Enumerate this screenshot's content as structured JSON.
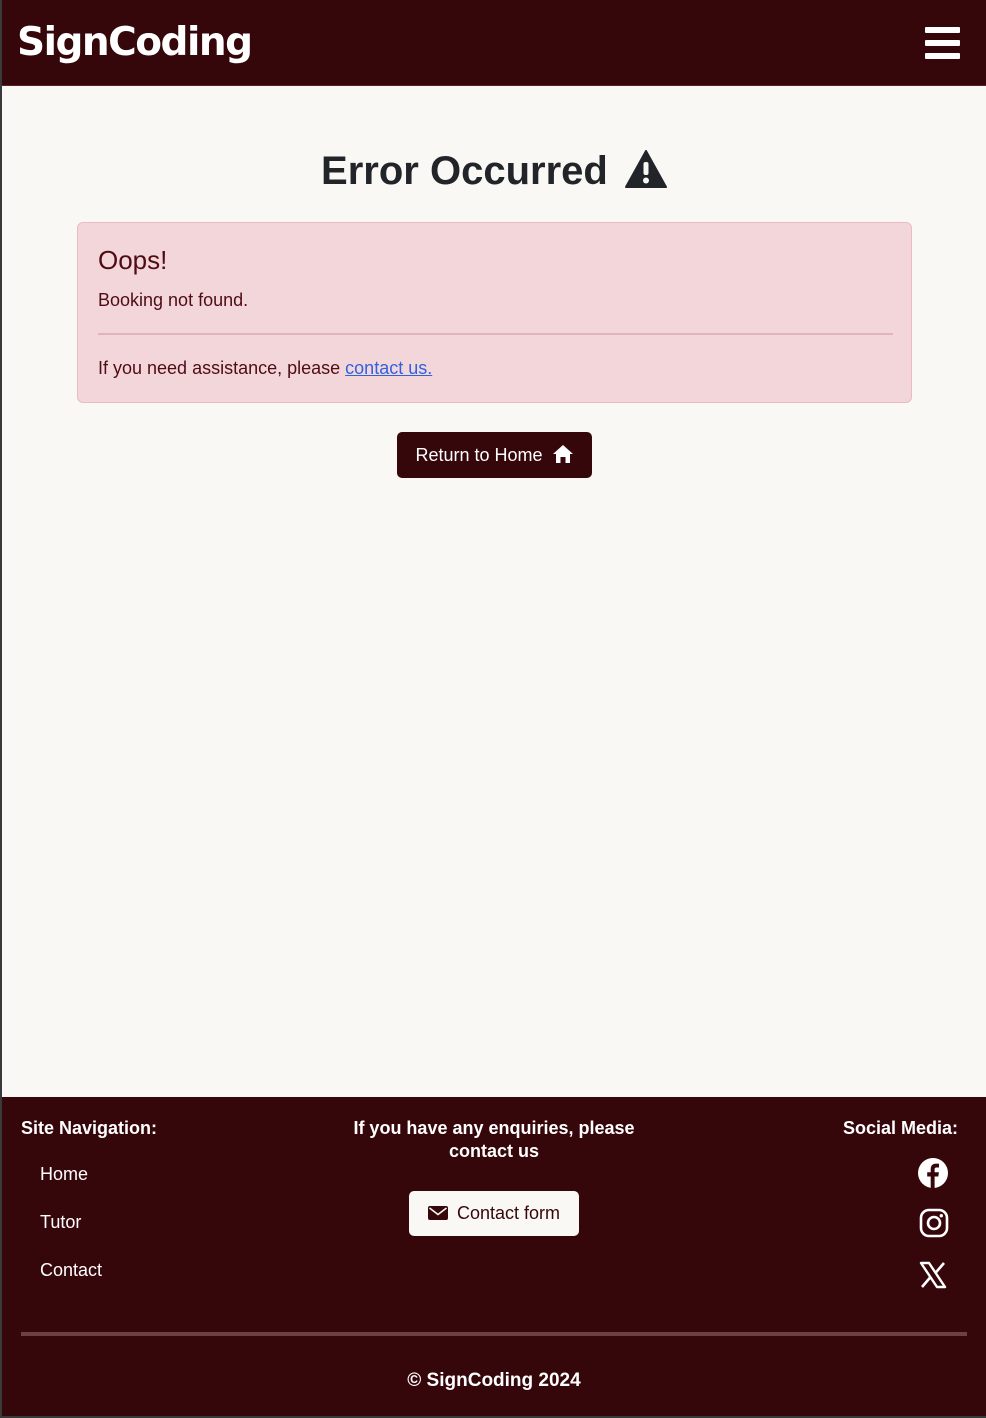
{
  "header": {
    "brand": "SignCoding",
    "menu_icon": "hamburger-menu-icon"
  },
  "main": {
    "title": "Error Occurred",
    "title_icon": "warning-triangle-icon",
    "alert": {
      "heading": "Oops!",
      "message": "Booking not found.",
      "help_prefix": "If you need assistance, please ",
      "help_link": "contact us."
    },
    "home_button": {
      "label": "Return to Home",
      "icon": "home-icon"
    }
  },
  "footer": {
    "nav_title": "Site Navigation:",
    "nav_items": [
      {
        "label": "Home"
      },
      {
        "label": "Tutor"
      },
      {
        "label": "Contact"
      }
    ],
    "enquiry_text": "If you have any enquiries, please contact us",
    "contact_button": {
      "label": "Contact form",
      "icon": "envelope-icon"
    },
    "social_title": "Social Media:",
    "social_icons": [
      "facebook-icon",
      "instagram-icon",
      "x-twitter-icon"
    ],
    "copyright": "© SignCoding 2024"
  },
  "colors": {
    "brand_dark": "#36070a",
    "page_bg": "#faf8f5",
    "alert_bg": "#f3d6d9",
    "alert_text": "#4e0c14",
    "link": "#2f62e0"
  }
}
